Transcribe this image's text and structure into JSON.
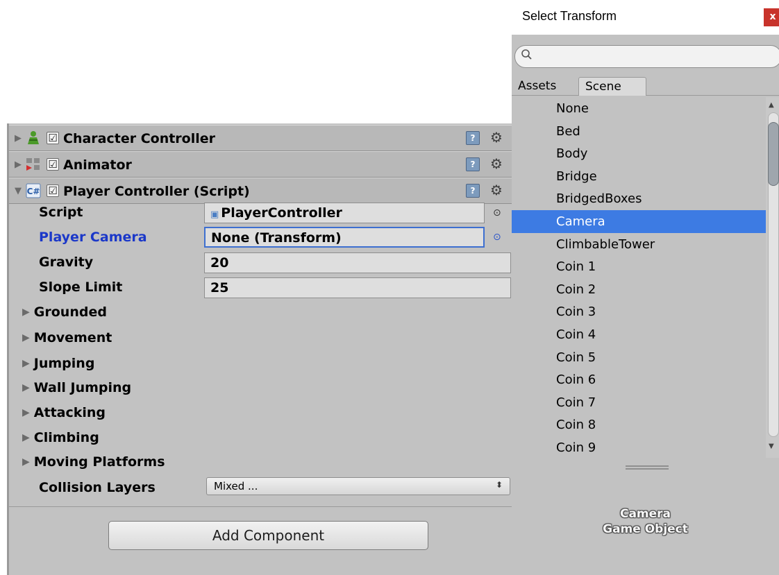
{
  "inspector": {
    "components": [
      {
        "title": "Character Controller",
        "icon": "character-controller-icon",
        "checked": true,
        "expanded": false
      },
      {
        "title": "Animator",
        "icon": "animator-icon",
        "checked": true,
        "expanded": false
      },
      {
        "title": "Player Controller (Script)",
        "icon": "csharp-script-icon",
        "checked": true,
        "expanded": true
      }
    ],
    "check_glyph": "☑",
    "help_glyph": "?",
    "gear_glyph": "⚙",
    "fold_collapsed": "▶",
    "fold_expanded": "▼",
    "properties": {
      "script": {
        "label": "Script",
        "value": "PlayerController"
      },
      "player_camera": {
        "label": "Player Camera",
        "value": "None (Transform)"
      },
      "gravity": {
        "label": "Gravity",
        "value": "20"
      },
      "slope_limit": {
        "label": "Slope Limit",
        "value": "25"
      }
    },
    "foldouts": [
      "Grounded",
      "Movement",
      "Jumping",
      "Wall Jumping",
      "Attacking",
      "Climbing",
      "Moving Platforms"
    ],
    "collision_layers": {
      "label": "Collision Layers",
      "value": "Mixed ..."
    },
    "add_component_label": "Add Component"
  },
  "select_window": {
    "title": "Select Transform",
    "close_label": "x",
    "search_placeholder": "",
    "tabs": [
      "Assets",
      "Scene"
    ],
    "active_tab": "Scene",
    "items": [
      "None",
      "Bed",
      "Body",
      "Bridge",
      "BridgedBoxes",
      "Camera",
      "ClimbableTower",
      "Coin 1",
      "Coin 2",
      "Coin 3",
      "Coin 4",
      "Coin 5",
      "Coin 6",
      "Coin 7",
      "Coin 8",
      "Coin 9"
    ],
    "selected": "Camera",
    "preview": {
      "name": "Camera",
      "type": "Game Object"
    }
  },
  "colors": {
    "selection": "#3d7be3",
    "active_label": "#1b38c9",
    "panel_bg": "#c2c2c2",
    "close_button": "#c8332b"
  }
}
